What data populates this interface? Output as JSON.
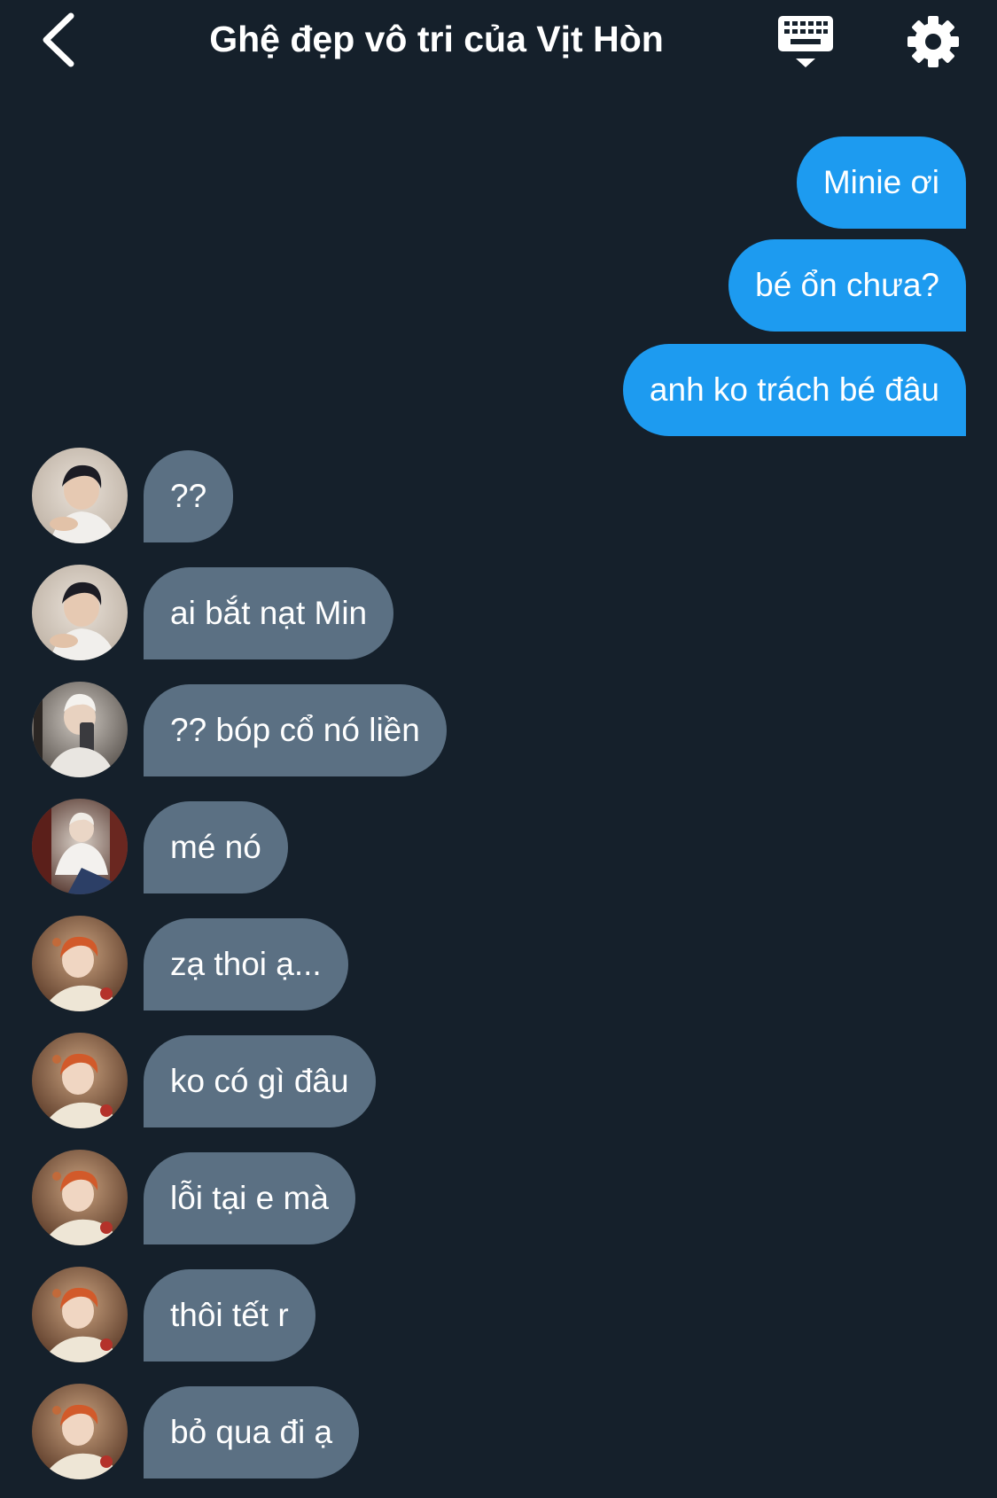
{
  "header": {
    "title": "Ghệ đẹp vô tri của Vịt Hòn",
    "back_icon": "chevron-left-icon",
    "keyboard_icon": "keyboard-icon",
    "settings_icon": "gear-icon"
  },
  "colors": {
    "background": "#15202b",
    "outgoing_bubble": "#1d9bf0",
    "incoming_bubble": "#5b7083",
    "text": "#ffffff"
  },
  "messages": [
    {
      "direction": "out",
      "text": "Minie ơi"
    },
    {
      "direction": "out",
      "text": "bé ổn chưa?"
    },
    {
      "direction": "out",
      "text": "anh ko trách bé đâu"
    },
    {
      "direction": "in",
      "text": "??",
      "avatar": "avatar-dark-hair-photo"
    },
    {
      "direction": "in",
      "text": "ai bắt nạt Min",
      "avatar": "avatar-dark-hair-photo"
    },
    {
      "direction": "in",
      "text": "?? bóp cổ nó liền",
      "avatar": "avatar-mirror-selfie-photo"
    },
    {
      "direction": "in",
      "text": "mé nó",
      "avatar": "avatar-seated-photo"
    },
    {
      "direction": "in",
      "text": "zạ thoi ạ...",
      "avatar": "avatar-orange-hair-photo"
    },
    {
      "direction": "in",
      "text": "ko có gì đâu",
      "avatar": "avatar-orange-hair-photo"
    },
    {
      "direction": "in",
      "text": "lỗi tại e mà",
      "avatar": "avatar-orange-hair-photo"
    },
    {
      "direction": "in",
      "text": "thôi tết r",
      "avatar": "avatar-orange-hair-photo"
    },
    {
      "direction": "in",
      "text": "bỏ qua đi ạ",
      "avatar": "avatar-orange-hair-photo"
    }
  ]
}
